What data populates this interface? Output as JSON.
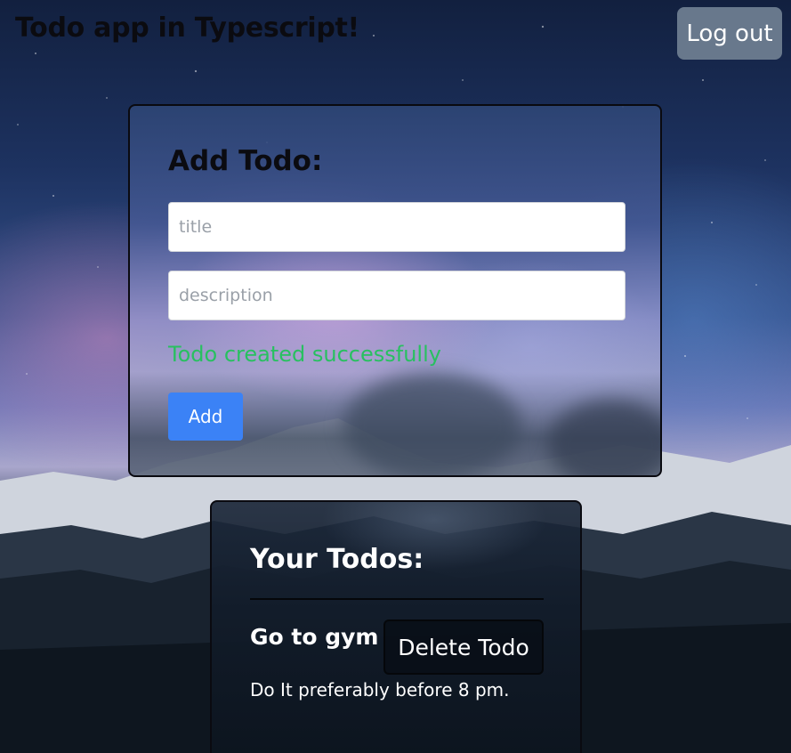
{
  "header": {
    "app_title": "Todo app in Typescript!",
    "logout_label": "Log out"
  },
  "add_todo": {
    "heading": "Add Todo:",
    "title_placeholder": "title",
    "description_placeholder": "description",
    "title_value": "",
    "description_value": "",
    "status_message": "Todo created successfully",
    "add_label": "Add"
  },
  "todos": {
    "heading": "Your Todos:",
    "items": [
      {
        "title": "Go to gym",
        "description": "Do It preferably before 8 pm.",
        "delete_label": "Delete Todo"
      }
    ]
  },
  "colors": {
    "accent_button": "#3b82f6",
    "success_text": "#28c060",
    "logout_button": "#68788c"
  }
}
